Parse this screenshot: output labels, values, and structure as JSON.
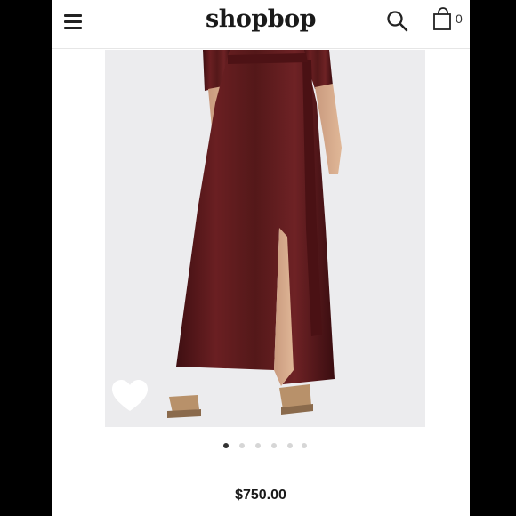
{
  "header": {
    "brand": "shopbop",
    "menu_icon": "hamburger-menu-icon",
    "search_icon": "search-icon",
    "bag_icon": "shopping-bag-icon",
    "bag_count": "0"
  },
  "product": {
    "price": "$750.00",
    "favorite_icon": "heart-icon",
    "image_description_colors": {
      "background": "#ececee",
      "dress": "#5a1a1c"
    }
  },
  "carousel": {
    "total_slides": 6,
    "active_index": 0
  }
}
